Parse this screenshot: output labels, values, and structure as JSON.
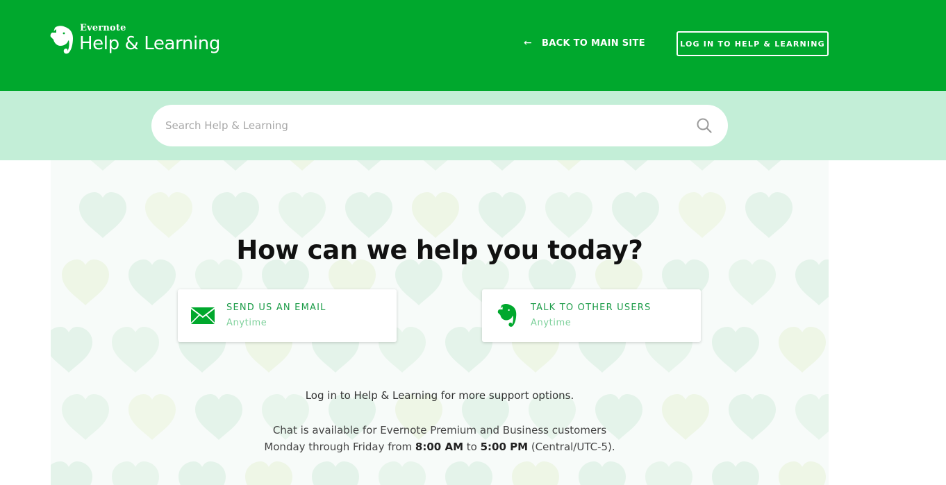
{
  "header": {
    "brand": "Evernote",
    "title": "Help & Learning",
    "back_link": "BACK TO MAIN SITE",
    "login_button": "LOG IN TO HELP & LEARNING"
  },
  "search": {
    "placeholder": "Search Help & Learning",
    "value": ""
  },
  "hero": {
    "headline": "How can we help you today?",
    "cards": [
      {
        "title": "SEND US AN EMAIL",
        "subtitle": "Anytime",
        "icon": "envelope-icon"
      },
      {
        "title": "TALK TO OTHER USERS",
        "subtitle": "Anytime",
        "icon": "elephant-icon"
      }
    ],
    "login_note": "Log in to Help & Learning for more support options.",
    "chat_line1": "Chat is available for Evernote Premium and Business customers",
    "chat_line2_prefix": "Monday through Friday from ",
    "chat_start": "8:00 AM",
    "chat_to": " to ",
    "chat_end": "5:00 PM",
    "chat_suffix": " (Central/UTC-5)."
  },
  "colors": {
    "brand_green": "#00a82d",
    "search_band": "#c3eed7",
    "accent_text": "#1c9c48",
    "muted_accent": "#7fd19c",
    "hero_bg": "#f7fbf9"
  }
}
